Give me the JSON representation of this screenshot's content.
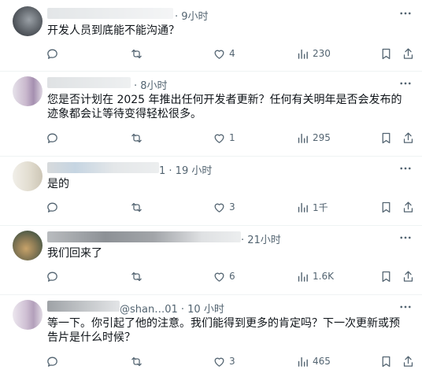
{
  "replies": [
    {
      "time": "· 9小时",
      "text": "开发人员到底能不能沟通？",
      "likes": "4",
      "views": "230"
    },
    {
      "time": "· 8小时",
      "text": "您是否计划在 2025 年推出任何开发者更新？任何有关明年是否会发布的迹象都会让等待变得轻松很多。",
      "likes": "1",
      "views": "295"
    },
    {
      "time": "1 · 19 小时",
      "text": "是的",
      "likes": "3",
      "views": "1千"
    },
    {
      "time": "· 21小时",
      "text": "我们回来了",
      "likes": "6",
      "views": "1.6K"
    },
    {
      "time": "@shan…01 · 10 小时",
      "text": "等一下。你引起了他的注意。我们能得到更多的肯定吗？下一次更新或预告片是什么时候？",
      "likes": "3",
      "views": "465"
    }
  ],
  "icons": {
    "more": "more-horizontal-icon",
    "reply": "reply-icon",
    "retweet": "retweet-icon",
    "like": "heart-icon",
    "views": "views-icon",
    "bookmark": "bookmark-icon",
    "share": "share-icon"
  },
  "colors": {
    "text": "#0f1419",
    "muted": "#536471",
    "divider": "#eff3f4"
  }
}
